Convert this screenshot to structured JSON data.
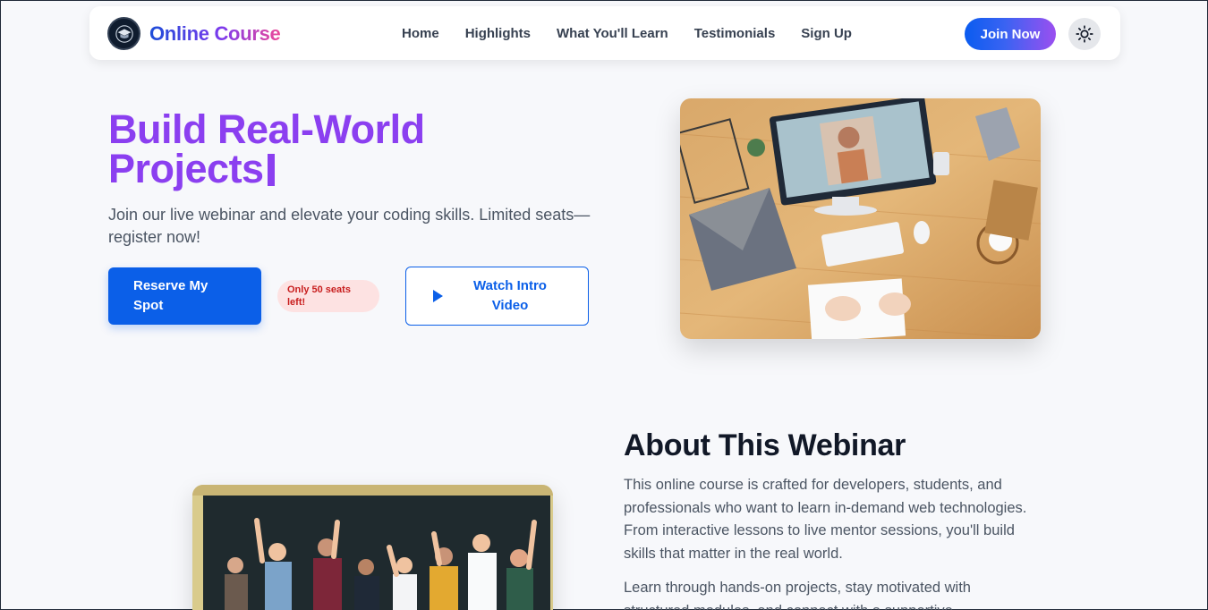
{
  "brand": {
    "name": "Online Course",
    "logo_icon": "graduation-cap-icon"
  },
  "nav": {
    "links": [
      "Home",
      "Highlights",
      "What You'll Learn",
      "Testimonials",
      "Sign Up"
    ],
    "cta": "Join Now",
    "theme_icon": "sun-icon"
  },
  "hero": {
    "title": "Build Real-World Projects",
    "subtitle": "Join our live webinar and elevate your coding skills. Limited seats—register now!",
    "reserve_label": "Reserve My Spot",
    "seats_badge": "Only 50 seats left!",
    "watch_label": "Watch Intro Video",
    "image_alt": "Workspace desk with video call on monitor"
  },
  "about": {
    "title": "About This Webinar",
    "paragraph1": "This online course is crafted for developers, students, and professionals who want to learn in-demand web technologies. From interactive lessons to live mentor sessions, you'll build skills that matter in the real world.",
    "paragraph2": "Learn through hands-on projects, stay motivated with structured modules, and connect with a supportive",
    "image_alt": "Group of students celebrating in front of chalkboard"
  },
  "colors": {
    "accent_blue": "#0b5fe8",
    "accent_purple": "#8b3ff0",
    "badge_red": "#c81e1e"
  }
}
